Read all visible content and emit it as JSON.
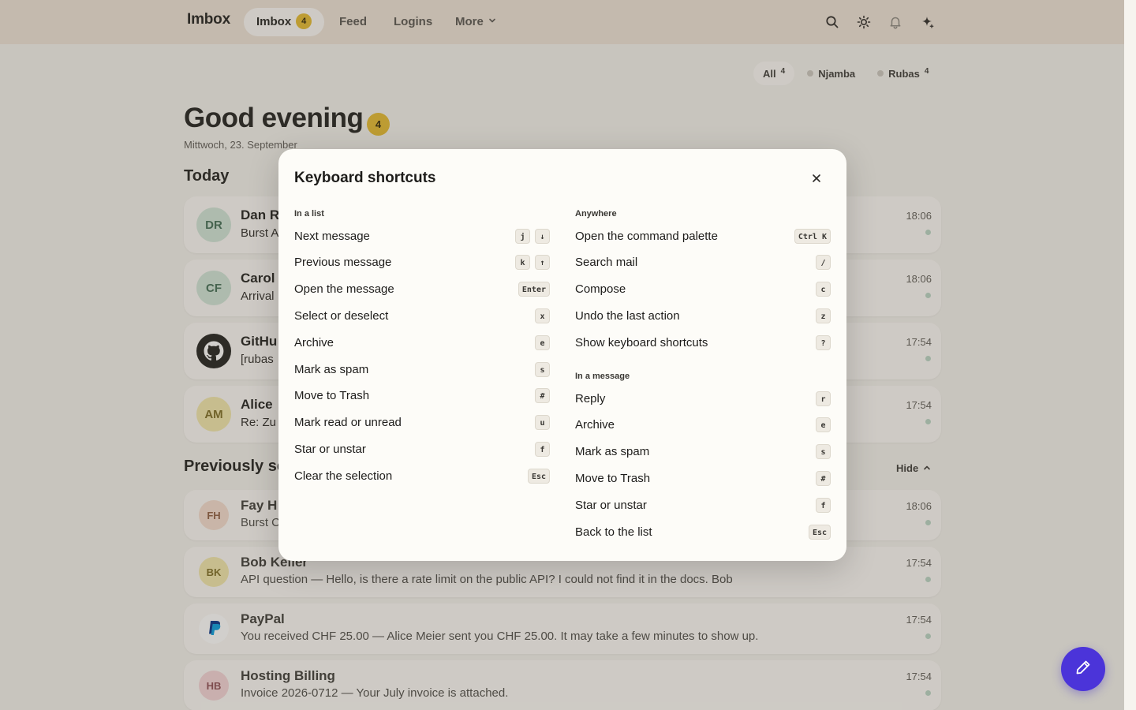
{
  "nav": {
    "brand": "Imbox",
    "tabs": [
      {
        "label": "Imbox",
        "count": "4"
      },
      {
        "label": "Feed"
      },
      {
        "label": "Logins"
      },
      {
        "label": "More"
      }
    ],
    "icons": [
      "search-icon",
      "brightness-icon",
      "bell-icon",
      "sparkle-icon"
    ]
  },
  "accounts": [
    {
      "label": "All",
      "count": "4"
    },
    {
      "label": "Njamba"
    },
    {
      "label": "Rubas",
      "count": "4"
    }
  ],
  "greeting": {
    "title": "Good evening",
    "badge": "4",
    "date": "Mittwoch, 23. September"
  },
  "sections": {
    "today": "Today",
    "previously": "Previously se",
    "hide": "Hide"
  },
  "today_mails": [
    {
      "initials": "DR",
      "sender": "Dan R",
      "preview": "Burst A",
      "time": "18:06",
      "avatar_bg": "#cfe3d6",
      "avatar_fg": "#3f6b53"
    },
    {
      "initials": "CF",
      "sender": "Carol",
      "preview": "Arrival",
      "time": "18:06",
      "avatar_bg": "#cfe3d6",
      "avatar_fg": "#3f6b53"
    },
    {
      "initials": "",
      "sender": "GitHu",
      "preview": "[rubas",
      "time": "17:54",
      "avatar_icon": "github-icon"
    },
    {
      "initials": "AM",
      "sender": "Alice",
      "preview": "Re: Zu",
      "time": "17:54",
      "avatar_bg": "#f2e6a9",
      "avatar_fg": "#7a6a1f"
    }
  ],
  "previous_mails": [
    {
      "initials": "FH",
      "sender": "Fay H",
      "preview": "Burst C",
      "time": "18:06",
      "avatar_bg": "#f4dccd",
      "avatar_fg": "#8d5a3d"
    },
    {
      "initials": "BK",
      "sender": "Bob Keller",
      "preview": "API question  — Hello, is there a rate limit on the public API? I could not find it in the docs. Bob",
      "time": "17:54",
      "avatar_bg": "#f2e6a9",
      "avatar_fg": "#7a6a1f"
    },
    {
      "initials": "",
      "sender": "PayPal",
      "preview": "You received CHF 25.00  — Alice Meier sent you CHF 25.00. It may take a few minutes to show up.",
      "time": "17:54",
      "avatar_icon": "paypal-icon"
    },
    {
      "initials": "HB",
      "sender": "Hosting Billing",
      "preview": "Invoice 2026-0712  — Your July invoice is attached.",
      "time": "17:54",
      "avatar_bg": "#f4d3d6",
      "avatar_fg": "#8d4a51"
    }
  ],
  "modal": {
    "title": "Keyboard shortcuts",
    "list_label": "In a list",
    "list": [
      {
        "label": "Next message",
        "keys": [
          "j",
          "↓"
        ]
      },
      {
        "label": "Previous message",
        "keys": [
          "k",
          "↑"
        ]
      },
      {
        "label": "Open the message",
        "keys": [
          "Enter"
        ]
      },
      {
        "label": "Select or deselect",
        "keys": [
          "x"
        ]
      },
      {
        "label": "Archive",
        "keys": [
          "e"
        ]
      },
      {
        "label": "Mark as spam",
        "keys": [
          "s"
        ]
      },
      {
        "label": "Move to Trash",
        "keys": [
          "#"
        ]
      },
      {
        "label": "Mark read or unread",
        "keys": [
          "u"
        ]
      },
      {
        "label": "Star or unstar",
        "keys": [
          "f"
        ]
      },
      {
        "label": "Clear the selection",
        "keys": [
          "Esc"
        ]
      }
    ],
    "anywhere_label": "Anywhere",
    "anywhere": [
      {
        "label": "Open the command palette",
        "keys": [
          "Ctrl K"
        ]
      },
      {
        "label": "Search mail",
        "keys": [
          "/"
        ]
      },
      {
        "label": "Compose",
        "keys": [
          "c"
        ]
      },
      {
        "label": "Undo the last action",
        "keys": [
          "z"
        ]
      },
      {
        "label": "Show keyboard shortcuts",
        "keys": [
          "?"
        ]
      }
    ],
    "message_label": "In a message",
    "message": [
      {
        "label": "Reply",
        "keys": [
          "r"
        ]
      },
      {
        "label": "Archive",
        "keys": [
          "e"
        ]
      },
      {
        "label": "Mark as spam",
        "keys": [
          "s"
        ]
      },
      {
        "label": "Move to Trash",
        "keys": [
          "#"
        ]
      },
      {
        "label": "Star or unstar",
        "keys": [
          "f"
        ]
      },
      {
        "label": "Back to the list",
        "keys": [
          "Esc"
        ]
      }
    ]
  },
  "colors": {
    "accent": "#4b34d9",
    "badge": "#e3b92b",
    "topbar": "#eee2d6"
  }
}
